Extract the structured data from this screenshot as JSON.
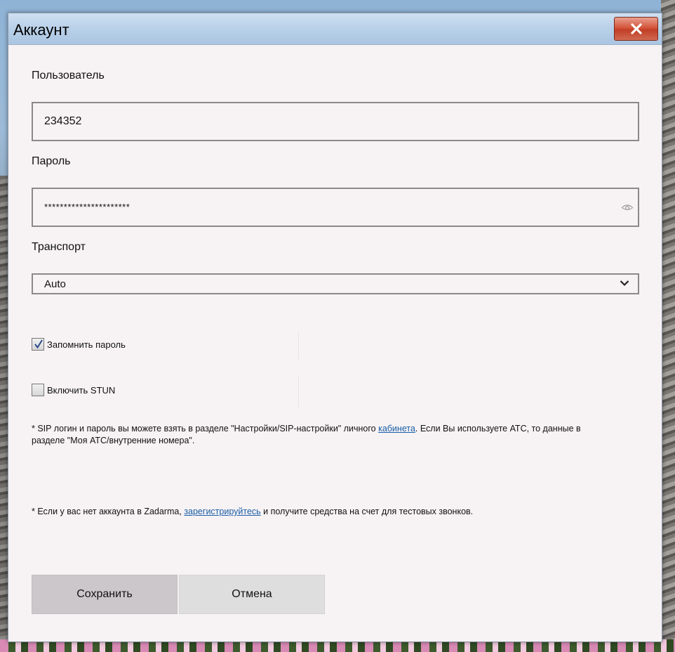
{
  "window": {
    "title": "Аккаунт",
    "close_icon": "close-icon"
  },
  "form": {
    "user_label": "Пользователь",
    "user_value": "234352",
    "password_label": "Пароль",
    "password_value": "**********************",
    "password_icon": "eye-icon",
    "transport_label": "Транспорт",
    "transport_value": "Auto",
    "transport_icon": "chevron-down-icon",
    "remember_label": "Запомнить пароль",
    "remember_checked": true,
    "stun_label": "Включить STUN",
    "stun_checked": false
  },
  "notes": {
    "sip_prefix": "* SIP логин и пароль вы можете взять в разделе \"Настройки/SIP-настройки\" личного ",
    "sip_link": "кабинета",
    "sip_suffix": ". Если Вы используете АТС, то данные в разделе \"Моя АТС/внутренние номера\".",
    "register_prefix": "* Если у вас нет аккаунта в Zadarma, ",
    "register_link": "зарегистрируйтесь",
    "register_suffix": " и получите средства на счет для тестовых звонков."
  },
  "buttons": {
    "save_label": "Сохранить",
    "cancel_label": "Отмена"
  },
  "colors": {
    "link": "#1a5fa8",
    "close_button": "#c13f26",
    "dialog_background": "#f7f2f4"
  }
}
